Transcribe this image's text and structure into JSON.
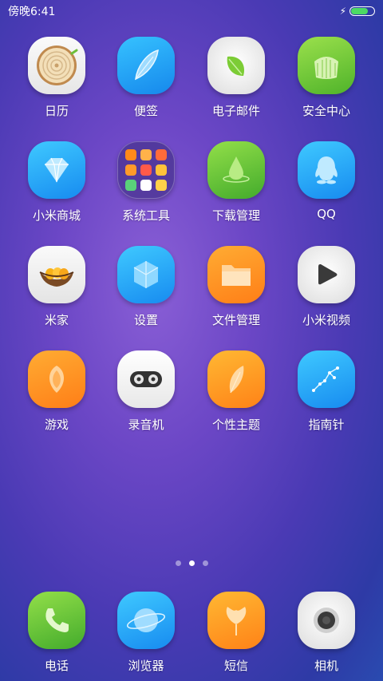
{
  "status": {
    "time": "傍晚6:41",
    "battery_level": 0.75
  },
  "apps": [
    {
      "name": "日历",
      "icon": "calendar-wood-icon"
    },
    {
      "name": "便签",
      "icon": "feather-notes-icon"
    },
    {
      "name": "电子邮件",
      "icon": "leaf-email-icon"
    },
    {
      "name": "安全中心",
      "icon": "shield-security-icon"
    },
    {
      "name": "小米商城",
      "icon": "diamond-store-icon"
    },
    {
      "name": "系统工具",
      "icon": "folder-tools-icon"
    },
    {
      "name": "下载管理",
      "icon": "drop-download-icon"
    },
    {
      "name": "QQ",
      "icon": "penguin-icon"
    },
    {
      "name": "米家",
      "icon": "nest-home-icon"
    },
    {
      "name": "设置",
      "icon": "hexagon-settings-icon"
    },
    {
      "name": "文件管理",
      "icon": "folder-files-icon"
    },
    {
      "name": "小米视频",
      "icon": "play-video-icon"
    },
    {
      "name": "游戏",
      "icon": "game-icon"
    },
    {
      "name": "录音机",
      "icon": "recorder-icon"
    },
    {
      "name": "个性主题",
      "icon": "theme-feather-icon"
    },
    {
      "name": "指南针",
      "icon": "compass-constellation-icon"
    }
  ],
  "dock": [
    {
      "name": "电话",
      "icon": "phone-icon"
    },
    {
      "name": "浏览器",
      "icon": "browser-planet-icon"
    },
    {
      "name": "短信",
      "icon": "ginkgo-sms-icon"
    },
    {
      "name": "相机",
      "icon": "camera-lens-icon"
    }
  ],
  "page_indicator": {
    "count": 3,
    "active": 2
  },
  "colors": {
    "orange": "#ff8a1a",
    "blue": "#1ea2f5",
    "green": "#6ccf3a",
    "white": "#f2f2f2"
  }
}
